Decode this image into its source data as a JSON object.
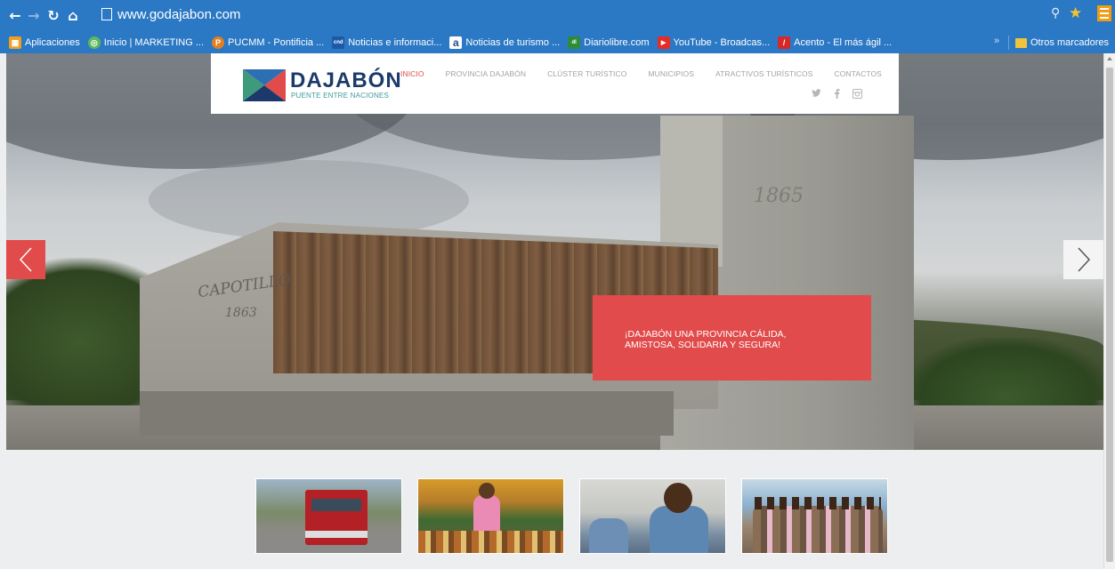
{
  "browser": {
    "url": "www.godajabon.com",
    "bookmarks": [
      {
        "label": "Aplicaciones",
        "icon": "apps-grid-icon",
        "color": "#f0a020"
      },
      {
        "label": "Inicio | MARKETING ...",
        "icon": "globe-icon",
        "color": "#5cb85c"
      },
      {
        "label": "PUCMM - Pontificia ...",
        "icon": "pucmm-icon",
        "color": "#e08020"
      },
      {
        "label": "Noticias e informaci...",
        "icon": "cnd-icon",
        "color": "#1c5aa8"
      },
      {
        "label": "Noticias de turismo ...",
        "icon": "a-icon",
        "color": "#1f4f8a"
      },
      {
        "label": "Diariolibre.com",
        "icon": "diariolibre-icon",
        "color": "#2e8b3a"
      },
      {
        "label": "YouTube - Broadcas...",
        "icon": "youtube-icon",
        "color": "#e52d27"
      },
      {
        "label": "Acento - El más ágil ...",
        "icon": "acento-icon",
        "color": "#d62828"
      }
    ],
    "bookmarks_overflow": "»",
    "other_bookmarks": "Otros marcadores"
  },
  "site": {
    "logo_title": "DAJABÓN",
    "logo_subtitle": "PUENTE ENTRE NACIONES",
    "nav": [
      {
        "label": "INICIO",
        "active": true
      },
      {
        "label": "PROVINCIA DAJABÓN",
        "active": false
      },
      {
        "label": "CLÚSTER TURÍSTICO",
        "active": false
      },
      {
        "label": "MUNICIPIOS",
        "active": false
      },
      {
        "label": "ATRACTIVOS TURÍSTICOS",
        "active": false
      },
      {
        "label": "CONTACTOS",
        "active": false
      }
    ],
    "social": [
      "twitter-icon",
      "facebook-icon",
      "instagram-icon"
    ],
    "accent_color": "#e14b4b"
  },
  "hero": {
    "caption": "¡DAJABÓN UNA PROVINCIA CÁLIDA, AMISTOSA, SOLIDARIA Y SEGURA!",
    "monument_text": {
      "tower_year": "1865",
      "wall_name": "CAPOTILLO",
      "wall_year": "1863"
    }
  },
  "thumbnails": [
    {
      "subject": "fire-truck"
    },
    {
      "subject": "market-vendor"
    },
    {
      "subject": "classroom-students"
    },
    {
      "subject": "group-photo"
    }
  ]
}
